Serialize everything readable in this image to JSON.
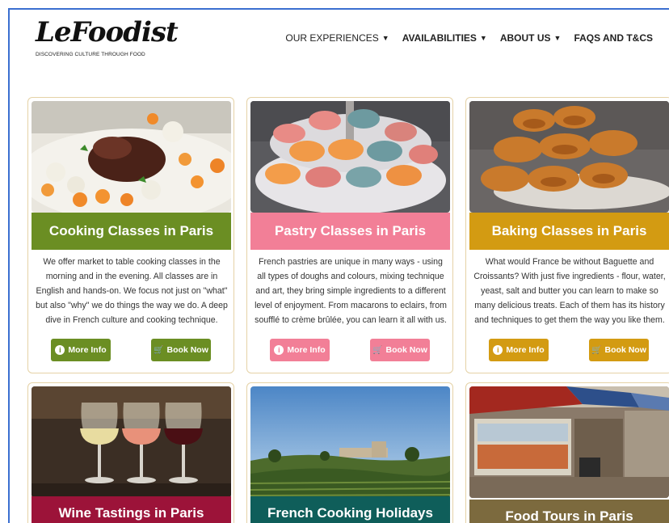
{
  "header": {
    "logo_text": "LeFoodist",
    "tagline": "DISCOVERING CULTURE THROUGH FOOD",
    "nav": [
      {
        "label": "OUR EXPERIENCES",
        "caret": true,
        "bold": false
      },
      {
        "label": "AVAILABILITIES",
        "caret": true,
        "bold": true
      },
      {
        "label": "ABOUT US",
        "caret": true,
        "bold": true
      },
      {
        "label": "FAQS AND T&CS",
        "caret": false,
        "bold": true
      }
    ]
  },
  "cards": [
    {
      "title": "Cooking Classes in Paris",
      "color": "#6b8e23",
      "description": "We offer market to table cooking classes in the morning and in the evening.  All classes are in English and hands-on.  We focus not just on \"what\" but also \"why\" we do things the way we do.  A deep dive in French culture and cooking technique.",
      "more_info": "More Info",
      "book_now": "Book Now"
    },
    {
      "title": "Pastry Classes in Paris",
      "color": "#f27f97",
      "description": "French pastries are unique in many ways - using all types of doughs and colours, mixing technique and art, they bring simple ingredients to a different level of enjoyment.  From macarons to eclairs, from soufflé to crème brûlée, you can learn it all with us.",
      "more_info": "More Info",
      "book_now": "Book Now"
    },
    {
      "title": "Baking Classes in Paris",
      "color": "#d39b12",
      "description": "What would France be without Baguette and Croissants?  With just five ingredients - flour, water, yeast, salt and butter you can learn to make so many delicious treats.  Each of them has its history and techniques to get them the way you like them.",
      "more_info": "More Info",
      "book_now": "Book Now"
    },
    {
      "title": "Wine Tastings in Paris",
      "color": "#9c1339"
    },
    {
      "title": "French Cooking Holidays",
      "color": "#0f5e5a"
    },
    {
      "title": "Food Tours in Paris",
      "color": "#7c6a3e"
    }
  ]
}
